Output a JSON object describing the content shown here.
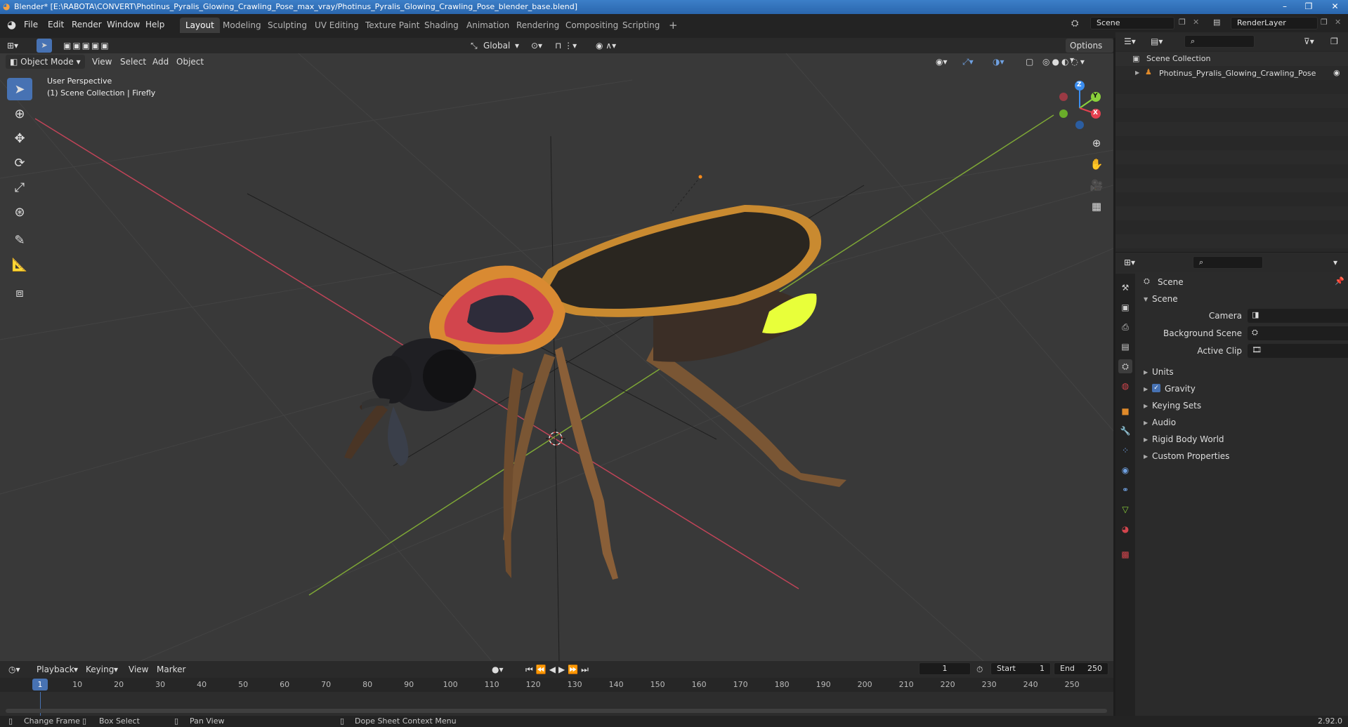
{
  "title_bar": {
    "text": "Blender* [E:\\RABOTA\\CONVERT\\Photinus_Pyralis_Glowing_Crawling_Pose_max_vray/Photinus_Pyralis_Glowing_Crawling_Pose_blender_base.blend]",
    "minimize": "–",
    "maximize": "❐",
    "close": "✕"
  },
  "menu": [
    "File",
    "Edit",
    "Render",
    "Window",
    "Help"
  ],
  "workspaces": [
    "Layout",
    "Modeling",
    "Sculpting",
    "UV Editing",
    "Texture Paint",
    "Shading",
    "Animation",
    "Rendering",
    "Compositing",
    "Scripting"
  ],
  "add_workspace": "+",
  "scene_selector": "Scene",
  "render_layer": "RenderLayer",
  "viewport": {
    "transform_orientation": "Global",
    "options": "Options",
    "mode": "Object Mode",
    "header_menus": [
      "View",
      "Select",
      "Add",
      "Object"
    ],
    "overlay_line1": "User Perspective",
    "overlay_line2": "(1) Scene Collection | Firefly",
    "gizmo": {
      "x": "X",
      "y": "Y",
      "z": "Z",
      "x_color": "#e5404f",
      "y_color": "#8ad13b",
      "z_color": "#3b8ef0"
    }
  },
  "timeline": {
    "menus": [
      "Playback",
      "Keying",
      "View",
      "Marker"
    ],
    "current_frame": "1",
    "start_label": "Start",
    "start": "1",
    "end_label": "End",
    "end": "250",
    "ruler": [
      "1",
      "10",
      "20",
      "30",
      "40",
      "50",
      "60",
      "70",
      "80",
      "90",
      "100",
      "110",
      "120",
      "130",
      "140",
      "150",
      "160",
      "170",
      "180",
      "190",
      "200",
      "210",
      "220",
      "230",
      "240",
      "250"
    ]
  },
  "outliner": {
    "root": "Scene Collection",
    "items": [
      "Photinus_Pyralis_Glowing_Crawling_Pose"
    ]
  },
  "properties": {
    "context": "Scene",
    "panel": "Scene",
    "fields": [
      {
        "label": "Camera"
      },
      {
        "label": "Background Scene"
      },
      {
        "label": "Active Clip"
      }
    ],
    "subpanels": [
      "Units",
      "Gravity",
      "Keying Sets",
      "Audio",
      "Rigid Body World",
      "Custom Properties"
    ]
  },
  "status_bar": {
    "items": [
      "Change Frame",
      "Box Select",
      "Pan View",
      "Dope Sheet Context Menu"
    ],
    "version": "2.92.0"
  },
  "colors": {
    "accent": "#4772b3",
    "glow": "#e8ff3a"
  }
}
